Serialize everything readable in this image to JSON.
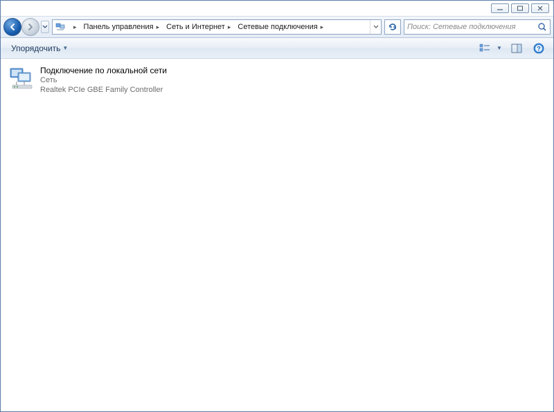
{
  "breadcrumbs": [
    "Панель управления",
    "Сеть и Интернет",
    "Сетевые подключения"
  ],
  "search": {
    "placeholder": "Поиск: Сетевые подключения"
  },
  "toolbar": {
    "organize": "Упорядочить"
  },
  "connections": [
    {
      "title": "Подключение по локальной сети",
      "status": "Сеть",
      "device": "Realtek PCIe GBE Family Controller"
    }
  ]
}
